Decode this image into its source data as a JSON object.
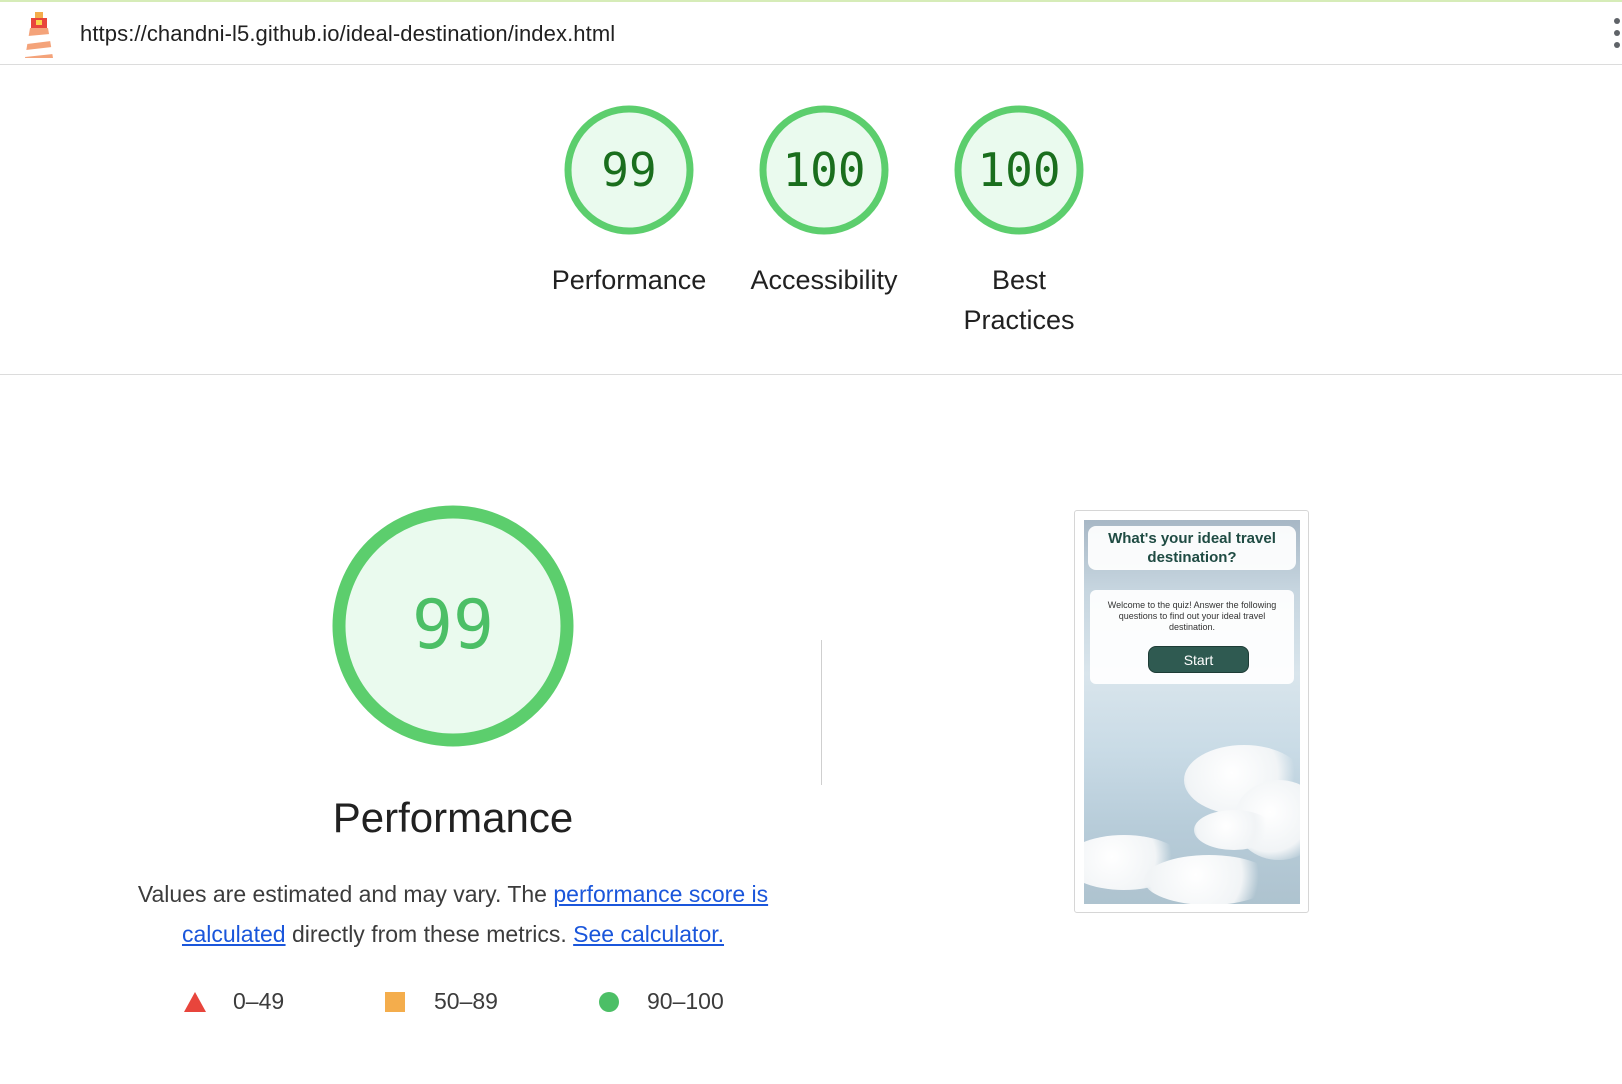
{
  "browser": {
    "url": "https://chandni-l5.github.io/ideal-destination/index.html"
  },
  "summary_gauges": [
    {
      "score": "99",
      "label": "Performance"
    },
    {
      "score": "100",
      "label": "Accessibility"
    },
    {
      "score": "100",
      "label_line1": "Best",
      "label_line2": "Practices"
    }
  ],
  "performance": {
    "score": "99",
    "title": "Performance",
    "desc_prefix": "Values are estimated and may vary. The ",
    "link1": "performance score is calculated",
    "desc_middle": " directly from these metrics. ",
    "link2": "See calculator."
  },
  "legend": [
    {
      "shape": "triangle",
      "color": "#e8453c",
      "range": "0–49"
    },
    {
      "shape": "square",
      "color": "#f4ad4c",
      "range": "50–89"
    },
    {
      "shape": "circle",
      "color": "#4cbf66",
      "range": "90–100"
    }
  ],
  "screenshot_preview": {
    "title": "What's your ideal travel destination?",
    "intro": "Welcome to the quiz! Answer the following questions to find out your ideal travel destination.",
    "start_label": "Start"
  },
  "colors": {
    "pass_ring": "#5cce6d",
    "pass_fill": "#eafaee",
    "pass_text_dark": "#1a6e1d",
    "pass_text_light": "#4cbf66",
    "link": "#1a56db"
  }
}
